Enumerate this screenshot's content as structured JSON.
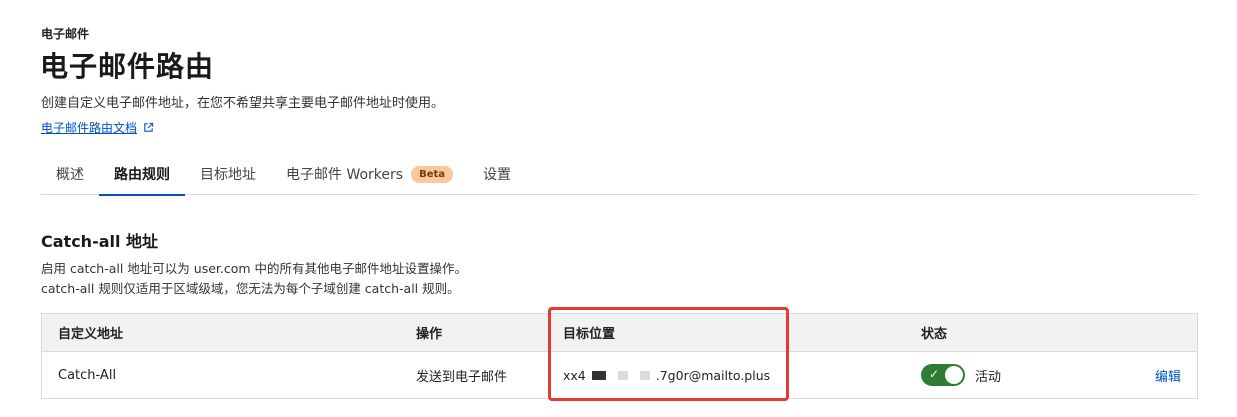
{
  "header": {
    "breadcrumb": "电子邮件",
    "title": "电子邮件路由",
    "description": "创建自定义电子邮件地址，在您不希望共享主要电子邮件地址时使用。",
    "docs_link": "电子邮件路由文档"
  },
  "tabs": [
    {
      "label": "概述",
      "active": false
    },
    {
      "label": "路由规则",
      "active": true
    },
    {
      "label": "目标地址",
      "active": false
    },
    {
      "label": "电子邮件 Workers",
      "active": false,
      "badge": "Beta"
    },
    {
      "label": "设置",
      "active": false
    }
  ],
  "catchall": {
    "title": "Catch-all 地址",
    "desc_line1": "启用 catch-all 地址可以为 user.com 中的所有其他电子邮件地址设置操作。",
    "desc_line2": "catch-all 规则仅适用于区域级域，您无法为每个子域创建 catch-all 规则。"
  },
  "table": {
    "headers": {
      "custom_address": "自定义地址",
      "action": "操作",
      "destination": "目标位置",
      "status": "状态"
    },
    "row": {
      "custom_address": "Catch-All",
      "action": "发送到电子邮件",
      "destination_prefix": "xx4",
      "destination_suffix": ".7g0r@mailto.plus",
      "status_enabled": true,
      "status_label": "活动",
      "edit": "编辑"
    }
  },
  "colors": {
    "accent": "#0051c3",
    "toggle_on": "#2e7d32",
    "highlight": "#e53935",
    "beta_badge": "#fbc79b"
  }
}
